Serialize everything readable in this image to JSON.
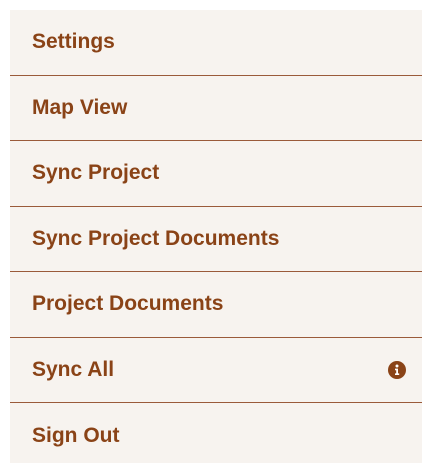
{
  "menu": {
    "items": [
      {
        "label": "Settings"
      },
      {
        "label": "Map View"
      },
      {
        "label": "Sync Project"
      },
      {
        "label": "Sync Project Documents"
      },
      {
        "label": "Project Documents"
      },
      {
        "label": "Sync All",
        "icon": "info-icon"
      },
      {
        "label": "Sign Out"
      }
    ]
  },
  "colors": {
    "background": "#f7f3ef",
    "label": "#8a4317",
    "divider": "#9a5a3a",
    "icon": "#8a4317"
  }
}
